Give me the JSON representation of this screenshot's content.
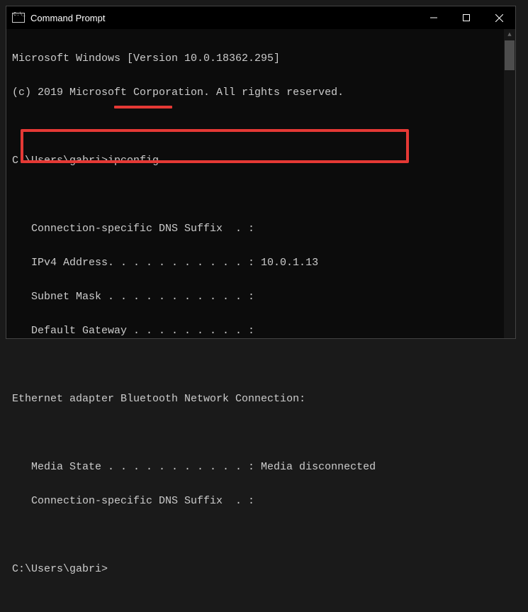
{
  "window": {
    "title": "Command Prompt"
  },
  "terminal": {
    "line1": "Microsoft Windows [Version 10.0.18362.295]",
    "line2": "(c) 2019 Microsoft Corporation. All rights reserved.",
    "blank1": "",
    "prompt1_path": "C:\\Users\\gabri>",
    "prompt1_cmd": "ipconfig",
    "blank2": "",
    "dns_suffix_partial": "Connection-specific DNS Suffix  . :",
    "ipv4_line": "IPv4 Address. . . . . . . . . . . : 10.0.1.13",
    "subnet_partial": "Subnet Mask . . . . . . . . . . . :",
    "gateway": "Default Gateway . . . . . . . . . :",
    "blank3": "",
    "adapter_header": "Ethernet adapter Bluetooth Network Connection:",
    "blank4": "",
    "media_state": "Media State . . . . . . . . . . . : Media disconnected",
    "dns_suffix2": "Connection-specific DNS Suffix  . :",
    "blank5": "",
    "prompt2": "C:\\Users\\gabri>"
  }
}
